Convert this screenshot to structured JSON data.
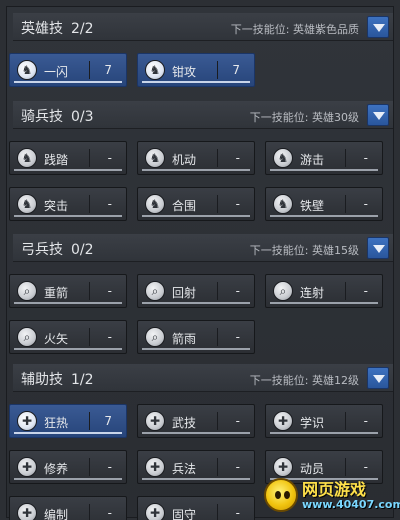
{
  "sections": [
    {
      "id": "hero",
      "title": "英雄技",
      "count": "2/2",
      "next_unlock": "下一技能位: 英雄紫色品质",
      "skills": [
        {
          "name": "一闪",
          "level": "7",
          "active": true,
          "icon": "cavalry-helmet-icon"
        },
        {
          "name": "钳攻",
          "level": "7",
          "active": true,
          "icon": "cavalry-helmet-icon"
        }
      ]
    },
    {
      "id": "cavalry",
      "title": "骑兵技",
      "count": "0/3",
      "next_unlock": "下一技能位: 英雄30级",
      "skills": [
        {
          "name": "践踏",
          "level": "-",
          "active": false,
          "icon": "cavalry-helmet-icon"
        },
        {
          "name": "机动",
          "level": "-",
          "active": false,
          "icon": "cavalry-helmet-icon"
        },
        {
          "name": "游击",
          "level": "-",
          "active": false,
          "icon": "cavalry-helmet-icon"
        },
        {
          "name": "突击",
          "level": "-",
          "active": false,
          "icon": "cavalry-helmet-icon"
        },
        {
          "name": "合围",
          "level": "-",
          "active": false,
          "icon": "cavalry-helmet-icon"
        },
        {
          "name": "铁壁",
          "level": "-",
          "active": false,
          "icon": "cavalry-helmet-icon"
        }
      ]
    },
    {
      "id": "archer",
      "title": "弓兵技",
      "count": "0/2",
      "next_unlock": "下一技能位: 英雄15级",
      "skills": [
        {
          "name": "重箭",
          "level": "-",
          "active": false,
          "icon": "bow-icon"
        },
        {
          "name": "回射",
          "level": "-",
          "active": false,
          "icon": "bow-icon"
        },
        {
          "name": "连射",
          "level": "-",
          "active": false,
          "icon": "bow-icon"
        },
        {
          "name": "火矢",
          "level": "-",
          "active": false,
          "icon": "bow-icon"
        },
        {
          "name": "箭雨",
          "level": "-",
          "active": false,
          "icon": "bow-icon"
        }
      ]
    },
    {
      "id": "support",
      "title": "辅助技",
      "count": "1/2",
      "next_unlock": "下一技能位: 英雄12级",
      "skills": [
        {
          "name": "狂热",
          "level": "7",
          "active": true,
          "icon": "shield-icon"
        },
        {
          "name": "武技",
          "level": "-",
          "active": false,
          "icon": "shield-icon"
        },
        {
          "name": "学识",
          "level": "-",
          "active": false,
          "icon": "shield-icon"
        },
        {
          "name": "修养",
          "level": "-",
          "active": false,
          "icon": "shield-icon"
        },
        {
          "name": "兵法",
          "level": "-",
          "active": false,
          "icon": "shield-icon"
        },
        {
          "name": "动员",
          "level": "-",
          "active": false,
          "icon": "shield-icon"
        },
        {
          "name": "编制",
          "level": "-",
          "active": false,
          "icon": "shield-icon"
        },
        {
          "name": "固守",
          "level": "-",
          "active": false,
          "icon": "shield-icon"
        }
      ]
    }
  ],
  "watermark": {
    "title": "网页游戏",
    "url": "www.40407.com"
  },
  "colors": {
    "active_skill": "#2f5088",
    "inactive_skill": "#33363c",
    "dropdown": "#3566b3",
    "background": "#2c2f34"
  }
}
